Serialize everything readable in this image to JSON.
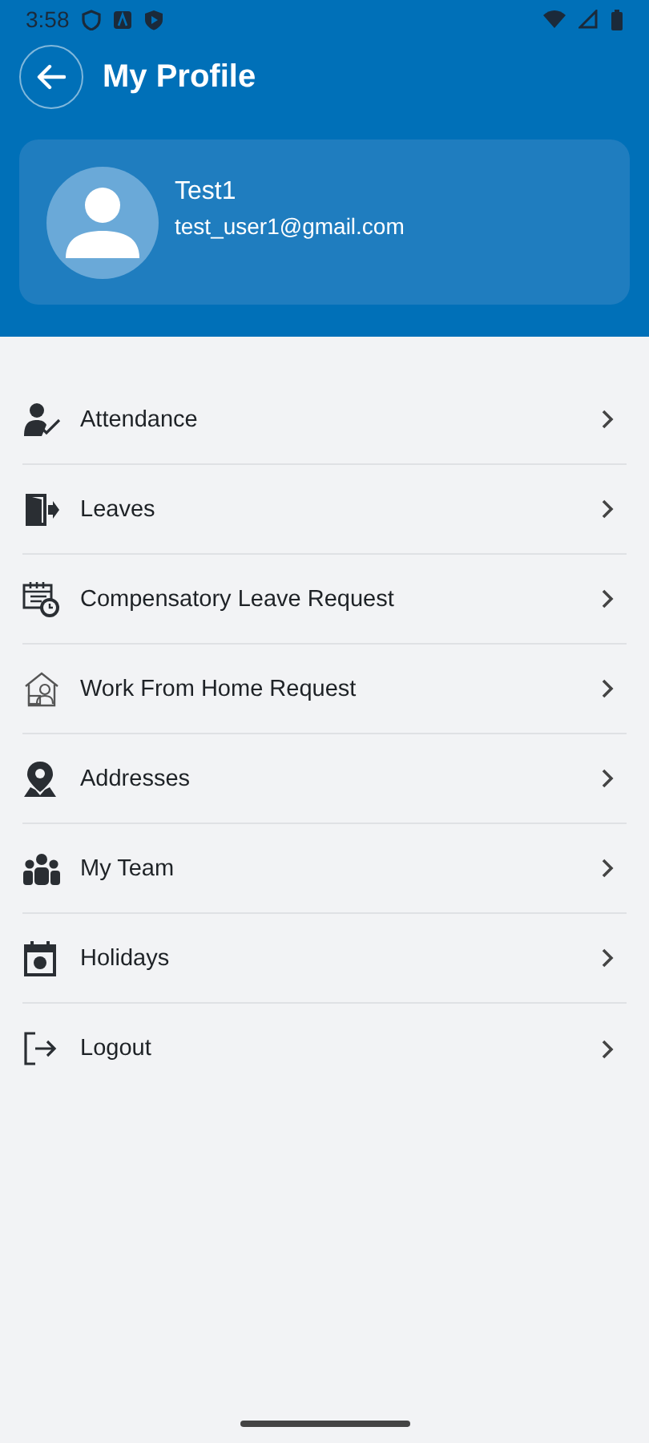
{
  "status_bar": {
    "time": "3:58"
  },
  "header": {
    "title": "My Profile"
  },
  "profile": {
    "name": "Test1",
    "email": "test_user1@gmail.com"
  },
  "menu": [
    {
      "label": "Attendance",
      "kind": "attendance"
    },
    {
      "label": "Leaves",
      "kind": "leaves"
    },
    {
      "label": "Compensatory Leave Request",
      "kind": "compensatory"
    },
    {
      "label": "Work From Home Request",
      "kind": "wfh"
    },
    {
      "label": "Addresses",
      "kind": "address"
    },
    {
      "label": "My Team",
      "kind": "team"
    },
    {
      "label": "Holidays",
      "kind": "holidays"
    },
    {
      "label": "Logout",
      "kind": "logout"
    }
  ]
}
